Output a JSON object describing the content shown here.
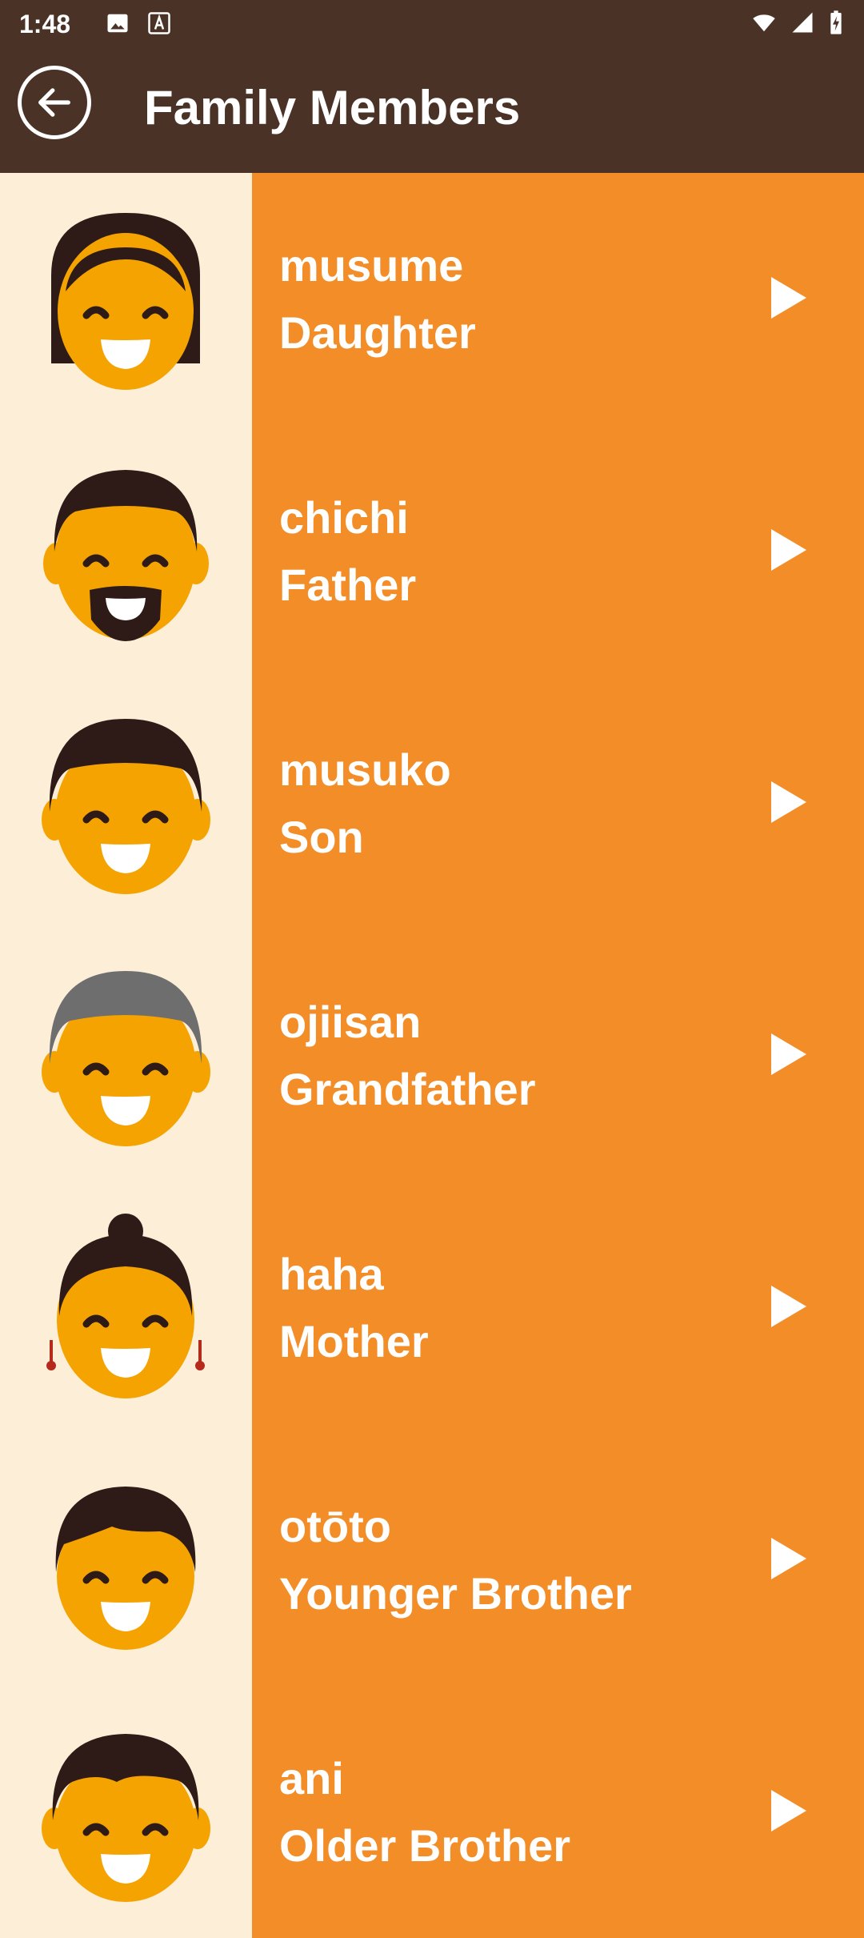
{
  "status_bar": {
    "time": "1:48",
    "icons": [
      "image-icon",
      "a-icon",
      "wifi-icon",
      "signal-icon",
      "battery-charging-icon"
    ]
  },
  "app_bar": {
    "title": "Family Members",
    "back_icon": "arrow-left-icon"
  },
  "colors": {
    "app_bar": "#4A3226",
    "item_background": "#F28D28",
    "image_background": "#FDEED8",
    "skin": "#F4A300",
    "hair_dark": "#2E1B17",
    "hair_gray": "#6E6E6E"
  },
  "family_members": [
    {
      "word": "musume",
      "translation": "Daughter",
      "face": "daughter"
    },
    {
      "word": "chichi",
      "translation": "Father",
      "face": "father"
    },
    {
      "word": "musuko",
      "translation": "Son",
      "face": "son"
    },
    {
      "word": "ojiisan",
      "translation": "Grandfather",
      "face": "grandfather"
    },
    {
      "word": "haha",
      "translation": "Mother",
      "face": "mother"
    },
    {
      "word": "otōto",
      "translation": "Younger Brother",
      "face": "younger-brother"
    },
    {
      "word": "ani",
      "translation": "Older Brother",
      "face": "older-brother"
    }
  ]
}
